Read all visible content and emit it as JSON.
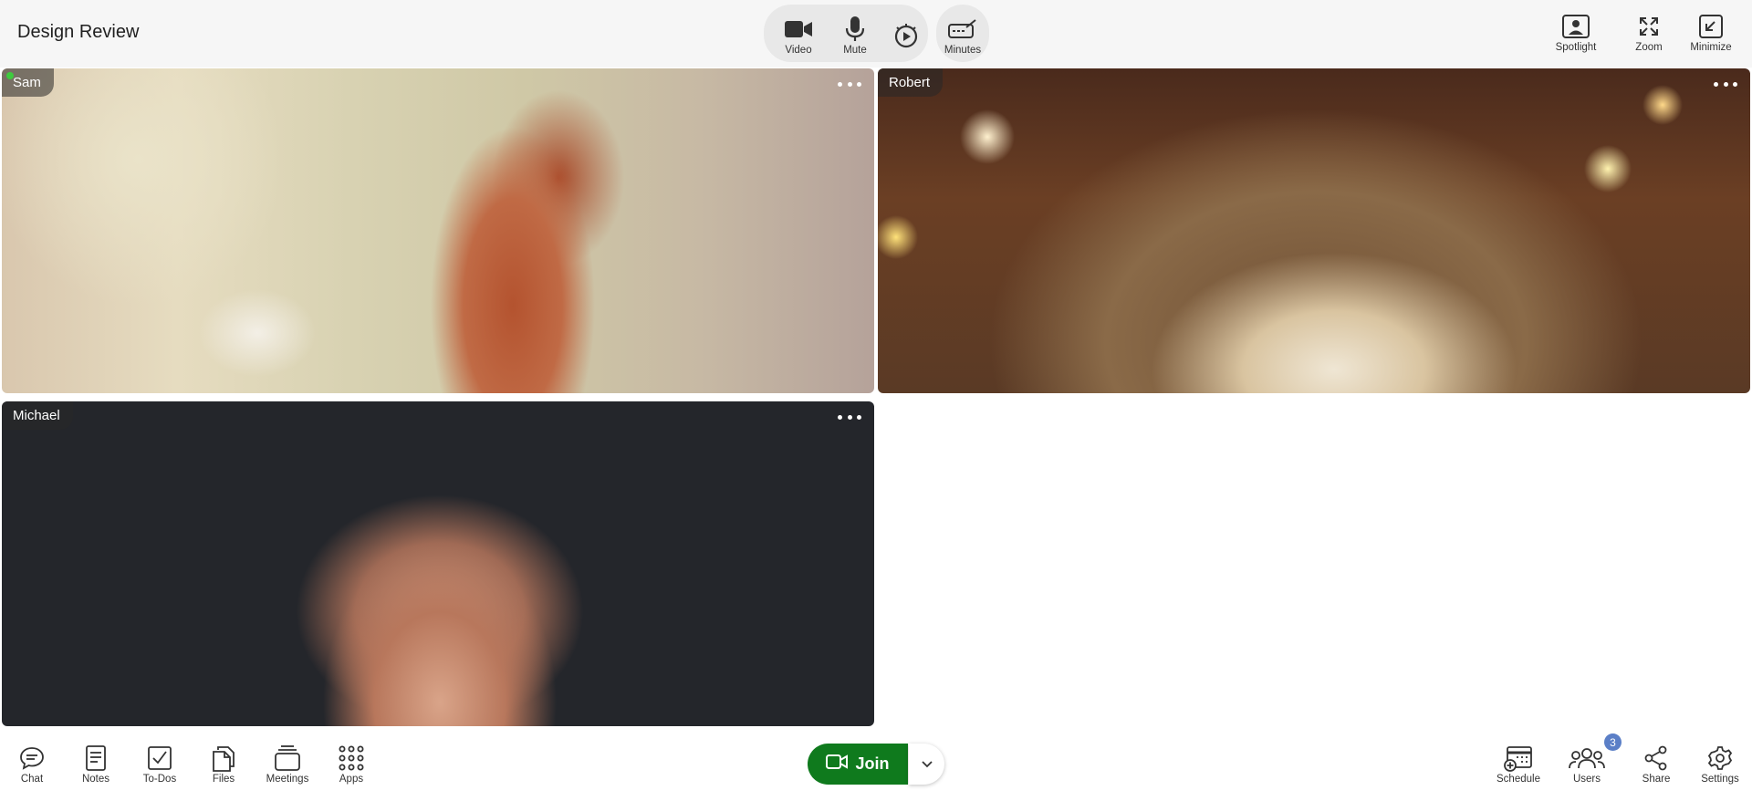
{
  "header": {
    "title": "Design Review",
    "center_controls": [
      {
        "label": "Video",
        "icon": "video-camera-icon"
      },
      {
        "label": "Mute",
        "icon": "microphone-icon"
      },
      {
        "label": "",
        "icon": "clock-play-icon"
      }
    ],
    "minutes_label": "Minutes",
    "right_controls": [
      {
        "label": "Spotlight",
        "icon": "spotlight-icon"
      },
      {
        "label": "Zoom",
        "icon": "expand-icon"
      },
      {
        "label": "Minimize",
        "icon": "minimize-icon"
      }
    ]
  },
  "participants": [
    {
      "name": "Sam",
      "active": true
    },
    {
      "name": "Robert",
      "active": false
    },
    {
      "name": "Michael",
      "active": false
    }
  ],
  "toolbar": {
    "left": [
      {
        "label": "Chat",
        "icon": "chat-icon"
      },
      {
        "label": "Notes",
        "icon": "notes-icon"
      },
      {
        "label": "To-Dos",
        "icon": "checkbox-icon"
      },
      {
        "label": "Files",
        "icon": "files-icon"
      },
      {
        "label": "Meetings",
        "icon": "meetings-icon"
      },
      {
        "label": "Apps",
        "icon": "apps-grid-icon"
      }
    ],
    "join_label": "Join",
    "right": [
      {
        "label": "Schedule",
        "icon": "calendar-add-icon"
      },
      {
        "label": "Users",
        "icon": "users-icon"
      },
      {
        "label": "Share",
        "icon": "share-icon"
      },
      {
        "label": "Settings",
        "icon": "gear-icon"
      }
    ],
    "users_badge": "3"
  },
  "colors": {
    "join_green": "#0f7a1d",
    "badge_blue": "#5b7fc7",
    "active_dot": "#3ecb3e"
  }
}
